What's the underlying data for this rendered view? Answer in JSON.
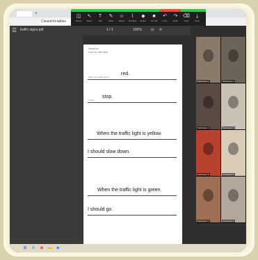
{
  "browser": {
    "new_tab_glyph": "+",
    "nav_back": "←",
    "nav_forward": "→",
    "nav_reload": "⟳",
    "url": "Closed-lit-tables"
  },
  "zoom_toolbar": {
    "tools": [
      {
        "icon": "◫",
        "label": "Mouse"
      },
      {
        "icon": "↖",
        "label": "Select"
      },
      {
        "icon": "T",
        "label": "Text"
      },
      {
        "icon": "✎",
        "label": "Draw"
      },
      {
        "icon": "☺",
        "label": "Stamp"
      },
      {
        "icon": "⌇",
        "label": "Spotlight"
      },
      {
        "icon": "◆",
        "label": "Eraser"
      },
      {
        "icon": "■",
        "label": "Format"
      },
      {
        "icon": "↶",
        "label": "Undo"
      },
      {
        "icon": "↷",
        "label": "Redo"
      },
      {
        "icon": "⌫",
        "label": "Clear"
      },
      {
        "icon": "⤓",
        "label": "Save"
      }
    ]
  },
  "pdf": {
    "title": "traffic signs.pdf",
    "page_indicator": "1 / 1",
    "zoom": "100%",
    "fit_icon": "⊡",
    "rotate_icon": "⟳"
  },
  "worksheet": {
    "heading1": "Worksheet",
    "heading2": "Color the traffic lights",
    "rows": [
      {
        "prompt": "When the traffic light is",
        "answer": "red."
      },
      {
        "prompt": "I must",
        "answer": "stop."
      },
      {
        "prompt": "",
        "answer": "When the traffic light is yellow."
      },
      {
        "prompt": "",
        "answer": "I should slow down."
      },
      {
        "prompt": "",
        "answer": "When the traffic light is green."
      },
      {
        "prompt": "",
        "answer": "I should go."
      }
    ]
  },
  "participants": [
    {
      "name": "Participant 1",
      "color": "#8a7a6a"
    },
    {
      "name": "Participant 2",
      "color": "#6b6458"
    },
    {
      "name": "Participant 3",
      "color": "#5a4a44"
    },
    {
      "name": "Participant 4",
      "color": "#c9c2b4"
    },
    {
      "name": "Participant 5",
      "color": "#b7422e"
    },
    {
      "name": "Participant 6",
      "color": "#d8cbb8"
    },
    {
      "name": "Participant 7",
      "color": "#9f6f55"
    },
    {
      "name": "Participant 8",
      "color": "#b3a79b"
    }
  ],
  "taskbar": {
    "icons": [
      {
        "name": "windows",
        "glyph": "⊞",
        "color": "#2b6fd6"
      },
      {
        "name": "edge",
        "glyph": "e",
        "color": "#1e88e5"
      },
      {
        "name": "chrome",
        "glyph": "◉",
        "color": "#e74c3c"
      },
      {
        "name": "folder",
        "glyph": "▬",
        "color": "#f4b400"
      },
      {
        "name": "zoom",
        "glyph": "▶",
        "color": "#2d8cff"
      }
    ]
  }
}
